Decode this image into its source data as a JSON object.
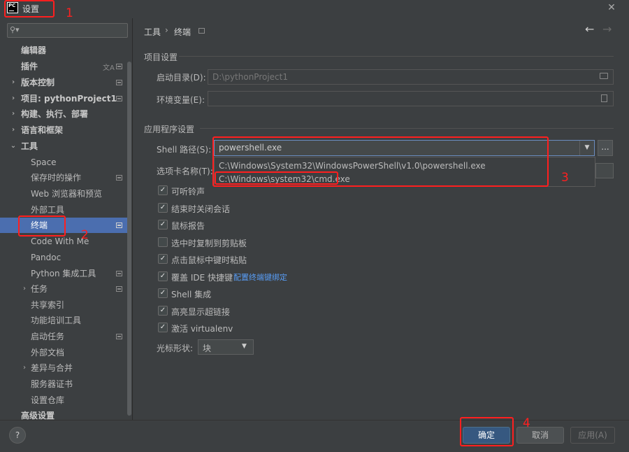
{
  "window": {
    "title": "设置",
    "logo_text": "PC",
    "close_glyph": "✕"
  },
  "search": {
    "placeholder": "",
    "icon": "search-icon"
  },
  "sidebar": {
    "items": [
      {
        "label": "编辑器"
      },
      {
        "label": "插件"
      },
      {
        "label": "版本控制"
      },
      {
        "label": "项目: pythonProject1"
      },
      {
        "label": "构建、执行、部署"
      },
      {
        "label": "语言和框架"
      },
      {
        "label": "工具"
      },
      {
        "label": "Space"
      },
      {
        "label": "保存时的操作"
      },
      {
        "label": "Web 浏览器和预览"
      },
      {
        "label": "外部工具"
      },
      {
        "label": "终端"
      },
      {
        "label": "Code With Me"
      },
      {
        "label": "Pandoc"
      },
      {
        "label": "Python 集成工具"
      },
      {
        "label": "任务"
      },
      {
        "label": "共享索引"
      },
      {
        "label": "功能培训工具"
      },
      {
        "label": "启动任务"
      },
      {
        "label": "外部文档"
      },
      {
        "label": "差异与合并"
      },
      {
        "label": "服务器证书"
      },
      {
        "label": "设置仓库"
      },
      {
        "label": "高级设置"
      }
    ],
    "selected_item": "终端",
    "collapsed_arrow": "›",
    "expanded_arrow": "⌄"
  },
  "breadcrumb": {
    "parent": "工具",
    "separator": "›",
    "current": "终端"
  },
  "nav": {
    "back": "←",
    "forward": "→"
  },
  "project_settings": {
    "title": "项目设置",
    "start_dir_label": "启动目录(D):",
    "start_dir_value": "D:\\pythonProject1",
    "env_vars_label": "环境变量(E):",
    "env_vars_value": ""
  },
  "app_settings": {
    "title": "应用程序设置",
    "shell_path_label": "Shell 路径(S):",
    "shell_path_value": "powershell.exe",
    "shell_browse": "...",
    "shell_options": [
      "C:\\Windows\\System32\\WindowsPowerShell\\v1.0\\powershell.exe",
      "C:\\Windows\\system32\\cmd.exe"
    ],
    "tab_name_label": "选项卡名称(T):",
    "checkboxes": [
      {
        "label": "可听铃声",
        "checked": true
      },
      {
        "label": "结束时关闭会话",
        "checked": true
      },
      {
        "label": "鼠标报告",
        "checked": true
      },
      {
        "label": "选中时复制到剪贴板",
        "checked": false
      },
      {
        "label": "点击鼠标中键时粘贴",
        "checked": true
      },
      {
        "label": "覆盖 IDE 快捷键",
        "checked": true
      },
      {
        "label": "Shell 集成",
        "checked": true
      },
      {
        "label": "高亮显示超链接",
        "checked": true
      },
      {
        "label": "激活 virtualenv",
        "checked": true
      }
    ],
    "configure_link": "配置终端键绑定",
    "cursor_shape_label": "光标形状:",
    "cursor_shape_value": "块",
    "check_glyph": "✓"
  },
  "footer": {
    "help": "?",
    "ok": "确定",
    "cancel": "取消",
    "apply": "应用(A)"
  },
  "annotations": {
    "labels": [
      "1",
      "2",
      "3",
      "4"
    ],
    "color": "#ff1f1f"
  }
}
